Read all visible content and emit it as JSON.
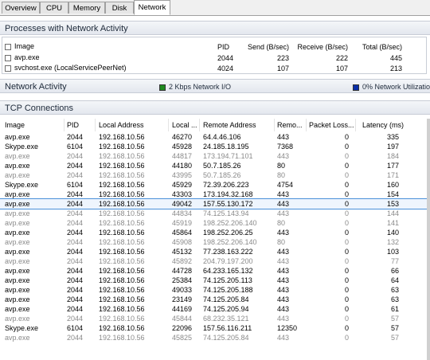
{
  "tabs": [
    {
      "label": "Overview"
    },
    {
      "label": "CPU"
    },
    {
      "label": "Memory"
    },
    {
      "label": "Disk"
    },
    {
      "label": "Network"
    }
  ],
  "processes": {
    "title": "Processes with Network Activity",
    "columns": {
      "image": "Image",
      "pid": "PID",
      "send": "Send (B/sec)",
      "receive": "Receive (B/sec)",
      "total": "Total (B/sec)"
    },
    "rows": [
      {
        "image": "avp.exe",
        "pid": "2044",
        "send": "223",
        "receive": "222",
        "total": "445"
      },
      {
        "image": "svchost.exe (LocalServicePeerNet)",
        "pid": "4024",
        "send": "107",
        "receive": "107",
        "total": "213"
      }
    ]
  },
  "network_activity": {
    "title": "Network Activity",
    "io_label": "2 Kbps Network I/O",
    "io_color": "#1f8a1f",
    "util_label": "0% Network Utilizatio",
    "util_color": "#0a2ea8"
  },
  "tcp": {
    "title": "TCP Connections",
    "columns": {
      "image": "Image",
      "pid": "PID",
      "local_address": "Local Address",
      "local_port": "Local ...",
      "remote_address": "Remote Address",
      "remote_port": "Remo...",
      "packet_loss": "Packet Loss...",
      "latency": "Latency (ms)"
    },
    "rows": [
      {
        "image": "avp.exe",
        "pid": "2044",
        "local_address": "192.168.10.56",
        "local_port": "46270",
        "remote_address": "64.4.46.106",
        "remote_port": "443",
        "packet_loss": "0",
        "latency": "335",
        "dim": false
      },
      {
        "image": "Skype.exe",
        "pid": "6104",
        "local_address": "192.168.10.56",
        "local_port": "45928",
        "remote_address": "24.185.18.195",
        "remote_port": "7368",
        "packet_loss": "0",
        "latency": "197",
        "dim": false
      },
      {
        "image": "avp.exe",
        "pid": "2044",
        "local_address": "192.168.10.56",
        "local_port": "44817",
        "remote_address": "173.194.71.101",
        "remote_port": "443",
        "packet_loss": "0",
        "latency": "184",
        "dim": true
      },
      {
        "image": "avp.exe",
        "pid": "2044",
        "local_address": "192.168.10.56",
        "local_port": "44180",
        "remote_address": "50.7.185.26",
        "remote_port": "80",
        "packet_loss": "0",
        "latency": "177",
        "dim": false
      },
      {
        "image": "avp.exe",
        "pid": "2044",
        "local_address": "192.168.10.56",
        "local_port": "43995",
        "remote_address": "50.7.185.26",
        "remote_port": "80",
        "packet_loss": "0",
        "latency": "171",
        "dim": true
      },
      {
        "image": "Skype.exe",
        "pid": "6104",
        "local_address": "192.168.10.56",
        "local_port": "45929",
        "remote_address": "72.39.206.223",
        "remote_port": "4754",
        "packet_loss": "0",
        "latency": "160",
        "dim": false
      },
      {
        "image": "avp.exe",
        "pid": "2044",
        "local_address": "192.168.10.56",
        "local_port": "43303",
        "remote_address": "173.194.32.168",
        "remote_port": "443",
        "packet_loss": "0",
        "latency": "154",
        "dim": false
      },
      {
        "image": "avp.exe",
        "pid": "2044",
        "local_address": "192.168.10.56",
        "local_port": "49042",
        "remote_address": "157.55.130.172",
        "remote_port": "443",
        "packet_loss": "0",
        "latency": "153",
        "dim": false,
        "selected": true
      },
      {
        "image": "avp.exe",
        "pid": "2044",
        "local_address": "192.168.10.56",
        "local_port": "44834",
        "remote_address": "74.125.143.94",
        "remote_port": "443",
        "packet_loss": "0",
        "latency": "144",
        "dim": true
      },
      {
        "image": "avp.exe",
        "pid": "2044",
        "local_address": "192.168.10.56",
        "local_port": "45919",
        "remote_address": "198.252.206.140",
        "remote_port": "80",
        "packet_loss": "0",
        "latency": "141",
        "dim": true
      },
      {
        "image": "avp.exe",
        "pid": "2044",
        "local_address": "192.168.10.56",
        "local_port": "45864",
        "remote_address": "198.252.206.25",
        "remote_port": "443",
        "packet_loss": "0",
        "latency": "140",
        "dim": false
      },
      {
        "image": "avp.exe",
        "pid": "2044",
        "local_address": "192.168.10.56",
        "local_port": "45908",
        "remote_address": "198.252.206.140",
        "remote_port": "80",
        "packet_loss": "0",
        "latency": "132",
        "dim": true
      },
      {
        "image": "avp.exe",
        "pid": "2044",
        "local_address": "192.168.10.56",
        "local_port": "45132",
        "remote_address": "77.238.163.222",
        "remote_port": "443",
        "packet_loss": "0",
        "latency": "103",
        "dim": false
      },
      {
        "image": "avp.exe",
        "pid": "2044",
        "local_address": "192.168.10.56",
        "local_port": "45892",
        "remote_address": "204.79.197.200",
        "remote_port": "443",
        "packet_loss": "0",
        "latency": "77",
        "dim": true
      },
      {
        "image": "avp.exe",
        "pid": "2044",
        "local_address": "192.168.10.56",
        "local_port": "44728",
        "remote_address": "64.233.165.132",
        "remote_port": "443",
        "packet_loss": "0",
        "latency": "66",
        "dim": false
      },
      {
        "image": "avp.exe",
        "pid": "2044",
        "local_address": "192.168.10.56",
        "local_port": "25384",
        "remote_address": "74.125.205.113",
        "remote_port": "443",
        "packet_loss": "0",
        "latency": "64",
        "dim": false
      },
      {
        "image": "avp.exe",
        "pid": "2044",
        "local_address": "192.168.10.56",
        "local_port": "49033",
        "remote_address": "74.125.205.188",
        "remote_port": "443",
        "packet_loss": "0",
        "latency": "63",
        "dim": false
      },
      {
        "image": "avp.exe",
        "pid": "2044",
        "local_address": "192.168.10.56",
        "local_port": "23149",
        "remote_address": "74.125.205.84",
        "remote_port": "443",
        "packet_loss": "0",
        "latency": "63",
        "dim": false
      },
      {
        "image": "avp.exe",
        "pid": "2044",
        "local_address": "192.168.10.56",
        "local_port": "44169",
        "remote_address": "74.125.205.94",
        "remote_port": "443",
        "packet_loss": "0",
        "latency": "61",
        "dim": false
      },
      {
        "image": "avp.exe",
        "pid": "2044",
        "local_address": "192.168.10.56",
        "local_port": "45844",
        "remote_address": "68.232.35.121",
        "remote_port": "443",
        "packet_loss": "0",
        "latency": "57",
        "dim": true
      },
      {
        "image": "Skype.exe",
        "pid": "6104",
        "local_address": "192.168.10.56",
        "local_port": "22096",
        "remote_address": "157.56.116.211",
        "remote_port": "12350",
        "packet_loss": "0",
        "latency": "57",
        "dim": false
      },
      {
        "image": "avp.exe",
        "pid": "2044",
        "local_address": "192.168.10.56",
        "local_port": "45825",
        "remote_address": "74.125.205.84",
        "remote_port": "443",
        "packet_loss": "0",
        "latency": "57",
        "dim": true
      }
    ]
  }
}
